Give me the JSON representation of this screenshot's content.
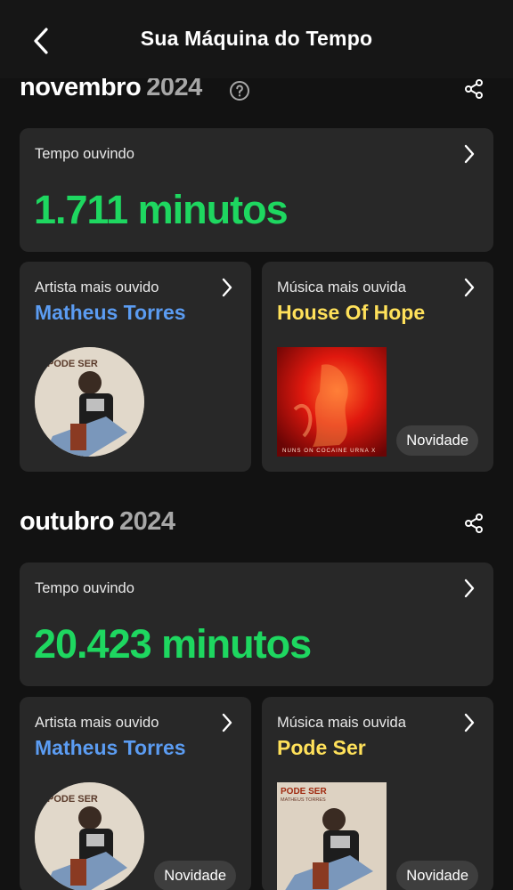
{
  "header": {
    "title": "Sua Máquina do Tempo"
  },
  "months": [
    {
      "month": "novembro",
      "year": "2024",
      "listening": {
        "label": "Tempo ouvindo",
        "value": "1.711 minutos"
      },
      "artist": {
        "label": "Artista mais ouvido",
        "name": "Matheus Torres",
        "avatar_text": "PODE SER"
      },
      "track": {
        "label": "Música mais ouvida",
        "name": "House Of Hope",
        "cover_text": "NUNS ON COCAINE URNA X",
        "badge": "Novidade"
      }
    },
    {
      "month": "outubro",
      "year": "2024",
      "listening": {
        "label": "Tempo ouvindo",
        "value": "20.423 minutos"
      },
      "artist": {
        "label": "Artista mais ouvido",
        "name": "Matheus Torres",
        "badge": "Novidade",
        "avatar_text": "PODE SER"
      },
      "track": {
        "label": "Música mais ouvida",
        "name": "Pode Ser",
        "cover_text": "PODE SER",
        "cover_subtext": "MATHEUS TORRES",
        "badge": "Novidade"
      }
    }
  ],
  "colors": {
    "minutes": "#1ed760",
    "artist": "#5b9cf2",
    "track": "#ffe15a",
    "card": "#282828",
    "background": "#121212"
  },
  "icons": {
    "back": "chevron-left-icon",
    "help": "question-circle-icon",
    "share": "share-icon",
    "open": "chevron-right-icon"
  }
}
